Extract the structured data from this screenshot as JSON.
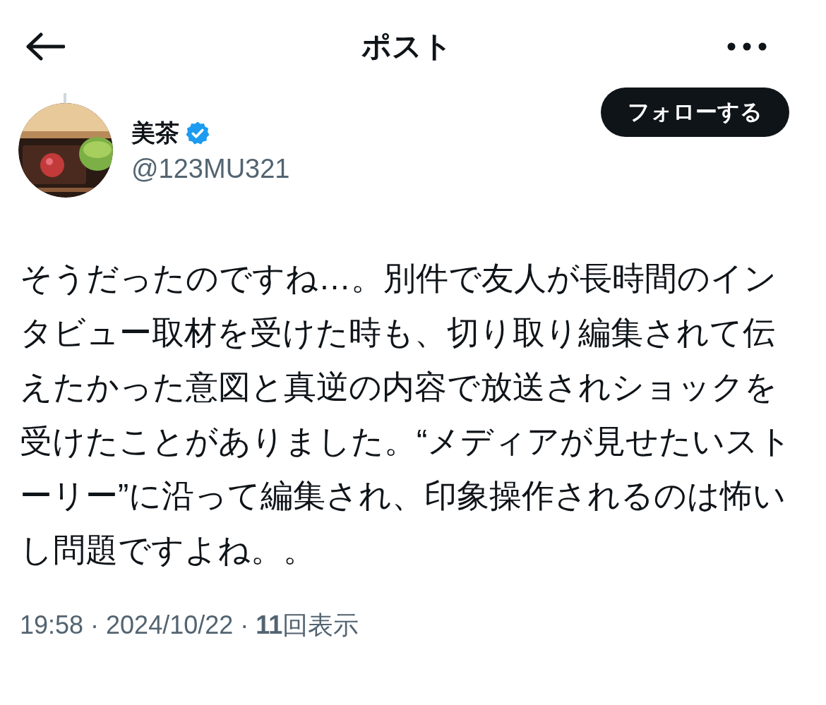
{
  "header": {
    "title": "ポスト"
  },
  "author": {
    "name": "美茶",
    "verified": true,
    "handle": "@123MU321"
  },
  "follow_button": {
    "label": "フォローする"
  },
  "post": {
    "text": "そうだったのですね…。別件で友人が長時間のインタビュー取材を受けた時も、切り取り編集されて伝えたかった意図と真逆の内容で放送されショックを受けたことがありました。“メディアが見せたいストーリー”に沿って編集され、印象操作されるのは怖いし問題ですよね。。",
    "meta": "19:58 · 2024/10/22 · **11**回表示"
  }
}
